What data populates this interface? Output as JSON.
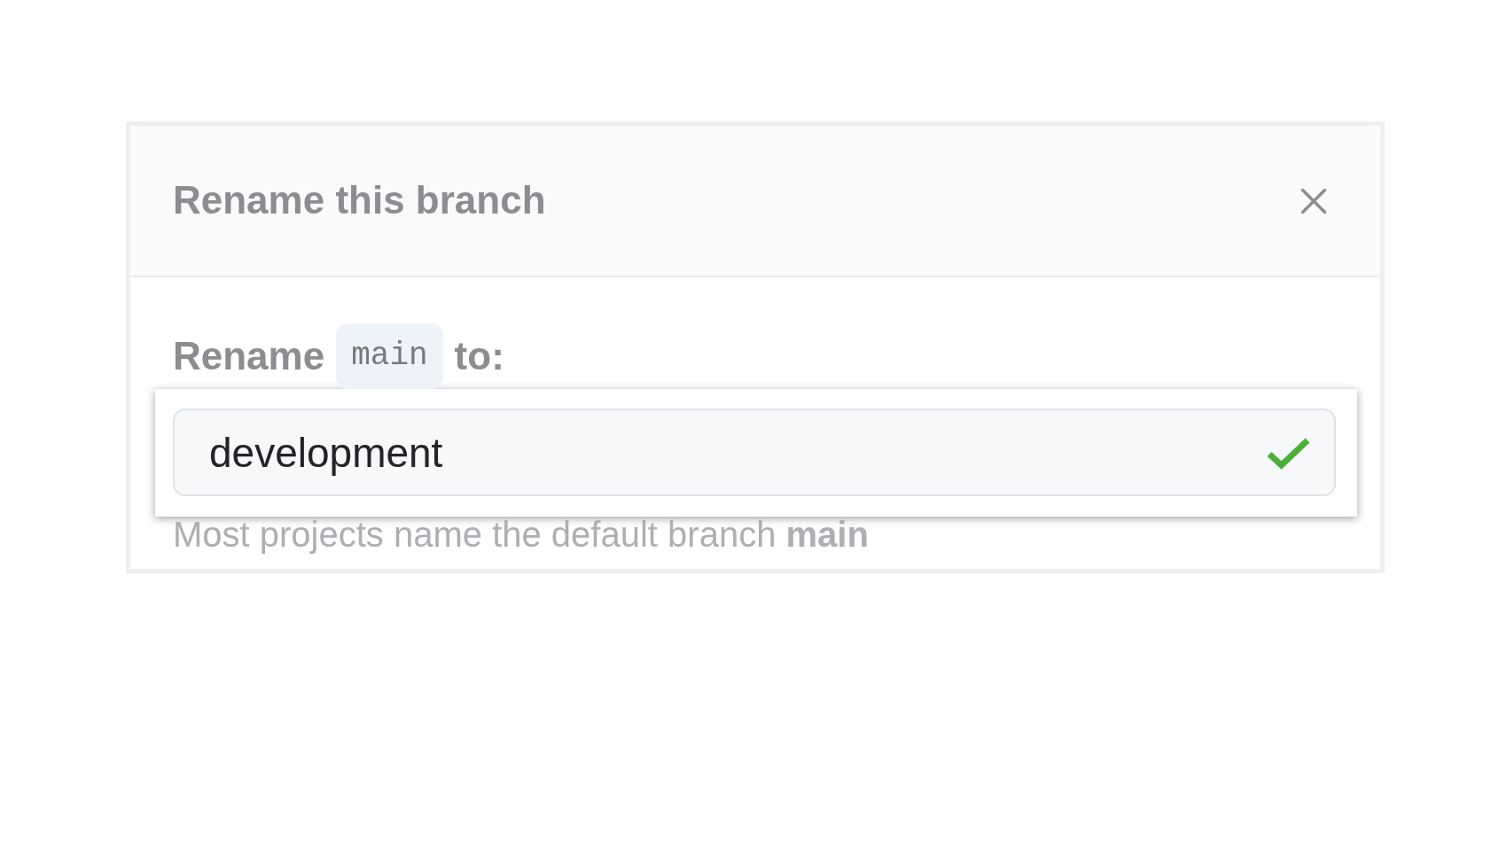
{
  "dialog": {
    "title": "Rename this branch",
    "closable": true
  },
  "label": [
    {
      "kind": "text",
      "text": "Rename"
    },
    {
      "kind": "code",
      "text": "main"
    },
    {
      "kind": "text",
      "text": "to:"
    }
  ],
  "field": {
    "value": "development",
    "valid": true,
    "highlighted": true
  },
  "hint": "Most projects name the default branch **main**"
}
